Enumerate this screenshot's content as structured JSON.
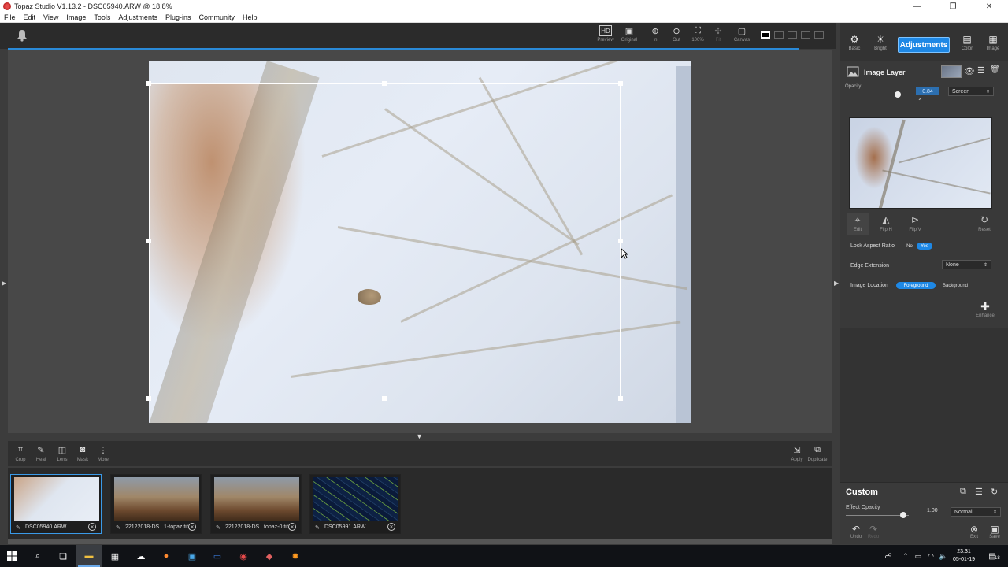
{
  "window": {
    "title": "Topaz Studio V1.13.2 - DSC05940.ARW @ 18.8%",
    "minimize": "—",
    "maximize": "❐",
    "close": "✕"
  },
  "menu": [
    "File",
    "Edit",
    "View",
    "Image",
    "Tools",
    "Adjustments",
    "Plug-ins",
    "Community",
    "Help"
  ],
  "toolbar": {
    "tools": [
      {
        "label": "Preview",
        "glyph": "HD"
      },
      {
        "label": "Original",
        "glyph": "▣"
      },
      {
        "label": "In",
        "glyph": "⊕"
      },
      {
        "label": "Out",
        "glyph": "⊖"
      },
      {
        "label": "100%",
        "glyph": "⛶"
      },
      {
        "label": "Fit",
        "glyph": "✣"
      },
      {
        "label": "Canvas",
        "glyph": "▢"
      }
    ]
  },
  "bottom_tools": [
    {
      "label": "Crop",
      "glyph": "⌗"
    },
    {
      "label": "Heal",
      "glyph": "✎"
    },
    {
      "label": "Lens",
      "glyph": "◫"
    },
    {
      "label": "Mask",
      "glyph": "◙"
    },
    {
      "label": "More",
      "glyph": "⋮"
    }
  ],
  "bottom_right_tools": [
    {
      "label": "Apply",
      "glyph": "⇲"
    },
    {
      "label": "Duplicate",
      "glyph": "⧉"
    }
  ],
  "filmstrip": [
    {
      "name": "DSC05940.ARW",
      "active": true
    },
    {
      "name": "22122018-DS...1-topaz.tif",
      "active": false
    },
    {
      "name": "22122018-DS...topaz-0.tif",
      "active": false
    },
    {
      "name": "DSC05991.ARW",
      "active": false
    }
  ],
  "right_panel": {
    "tabs": [
      {
        "label": "Basic",
        "glyph": "⚙"
      },
      {
        "label": "Bright",
        "glyph": "☀"
      },
      {
        "label": "Color",
        "glyph": "▤"
      },
      {
        "label": "Image",
        "glyph": "▦"
      }
    ],
    "active_tab": "Adjustments",
    "layer": {
      "title": "Image Layer",
      "opacity_label": "Opacity",
      "opacity_value": "0.84",
      "opacity_fraction": 0.84,
      "blend_mode": "Screen"
    },
    "edit_tools": [
      {
        "label": "Edit",
        "glyph": "⌖"
      },
      {
        "label": "Flip H",
        "glyph": "◭"
      },
      {
        "label": "Flip V",
        "glyph": "⊳"
      },
      {
        "label": "Reset",
        "glyph": "↻"
      }
    ],
    "lock_aspect": {
      "label": "Lock Aspect Ratio",
      "no": "No",
      "yes": "Yes"
    },
    "edge_extension": {
      "label": "Edge Extension",
      "value": "None"
    },
    "image_location": {
      "label": "Image Location",
      "foreground": "Foreground",
      "background": "Background"
    },
    "enhance_label": "Enhance",
    "custom": {
      "title": "Custom",
      "effect_opacity_label": "Effect Opacity",
      "effect_opacity_value": "1.00",
      "blend_mode": "Normal",
      "undo": "Undo",
      "redo": "Redo",
      "exit": "Exit",
      "save": "Save"
    }
  },
  "taskbar": {
    "time": "23:31",
    "date": "05-01-19",
    "notifications": "18"
  },
  "colors": {
    "accent": "#1e88e5",
    "panel": "#333333",
    "canvas": "#484848"
  }
}
